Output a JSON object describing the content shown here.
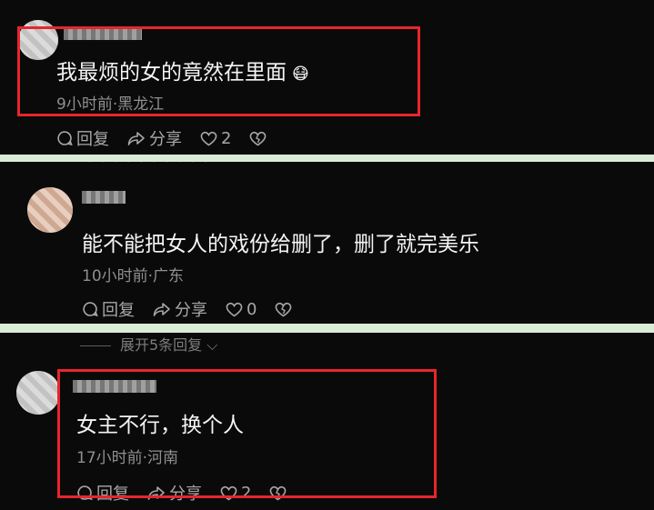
{
  "comments": [
    {
      "text": "我最烦的女的竟然在里面",
      "emoji": "😷",
      "meta": "9小时前·黑龙江",
      "reply_label": "回复",
      "share_label": "分享",
      "like_count": "2"
    },
    {
      "text": "能不能把女人的戏份给删了，删了就完美乐",
      "meta": "10小时前·广东",
      "reply_label": "回复",
      "share_label": "分享",
      "like_count": "0"
    },
    {
      "text": "女主不行，换个人",
      "meta": "17小时前·河南",
      "reply_label": "回复",
      "share_label": "分享",
      "like_count": "2"
    }
  ],
  "expand_replies": "展开5条回复",
  "colors": {
    "highlight_border": "#e8252e",
    "separator": "#d9ecd6",
    "background": "#0a0a0a"
  }
}
